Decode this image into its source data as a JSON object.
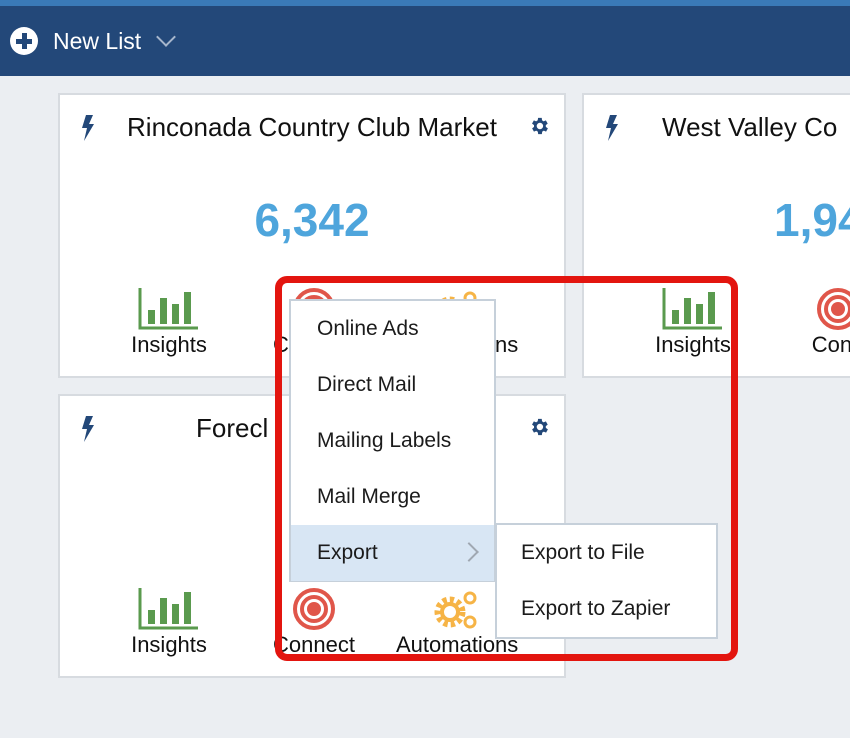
{
  "header": {
    "new_list_label": "New List"
  },
  "cards": [
    {
      "title": "Rinconada Country Club Market",
      "count": "6,342",
      "actions": [
        "Insights",
        "Connect",
        "Automations"
      ]
    },
    {
      "title": "West Valley Co",
      "count": "1,94",
      "actions": [
        "Insights",
        "Conn"
      ]
    },
    {
      "title": "Forecl",
      "count": "",
      "actions": [
        "Insights",
        "Connect",
        "Automations"
      ]
    }
  ],
  "context_menu": {
    "items": [
      {
        "label": "Online Ads"
      },
      {
        "label": "Direct Mail"
      },
      {
        "label": "Mailing Labels"
      },
      {
        "label": "Mail Merge"
      },
      {
        "label": "Export",
        "has_submenu": true,
        "active": true
      }
    ],
    "submenu": {
      "items": [
        {
          "label": "Export to File"
        },
        {
          "label": "Export to Zapier"
        }
      ]
    }
  },
  "colors": {
    "header_bg": "#234879",
    "count_blue": "#4ea5dc",
    "insights_green": "#5a9a4e",
    "connect_red": "#e0564a",
    "automations_orange": "#f6b446",
    "highlight_red": "#e3150f",
    "menu_active_bg": "#d8e6f4"
  }
}
